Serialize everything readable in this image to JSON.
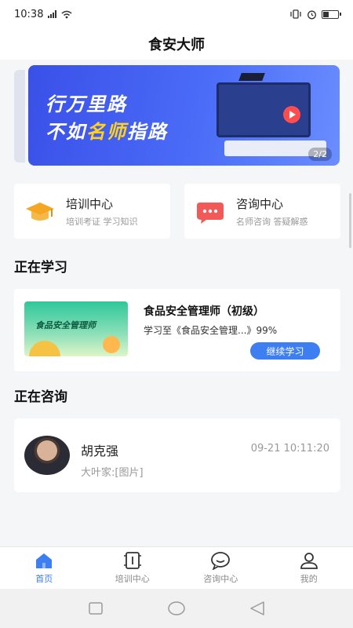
{
  "status_bar": {
    "time": "10:38"
  },
  "header": {
    "title": "食安大师"
  },
  "banner": {
    "line1": "行万里路",
    "line2_prefix": "不如",
    "line2_highlight": "名师",
    "line2_suffix": "指路",
    "page_indicator": "2/2"
  },
  "quick_entries": [
    {
      "title": "培训中心",
      "subtitle": "培训考证 学习知识",
      "icon": "graduation-cap-icon",
      "color": "#f5a623"
    },
    {
      "title": "咨询中心",
      "subtitle": "名师咨询 答疑解惑",
      "icon": "chat-bubble-icon",
      "color": "#f25a5a"
    }
  ],
  "learning": {
    "section_title": "正在学习",
    "course_thumb_title": "食品安全管理师",
    "course_name": "食品安全管理师（初级）",
    "progress_text": "学习至《食品安全管理...》99%",
    "progress_value": 0.99,
    "continue_label": "继续学习"
  },
  "consulting": {
    "section_title": "正在咨询",
    "consultant_name": "胡克强",
    "time": "09-21 10:11:20",
    "last_message": "大叶家:[图片]"
  },
  "tabbar": {
    "items": [
      {
        "label": "首页",
        "icon": "home-icon",
        "active": true
      },
      {
        "label": "培训中心",
        "icon": "training-icon",
        "active": false
      },
      {
        "label": "咨询中心",
        "icon": "chat-icon",
        "active": false
      },
      {
        "label": "我的",
        "icon": "user-icon",
        "active": false
      }
    ]
  },
  "colors": {
    "accent": "#3d7ef0",
    "banner": "#4a6cf7",
    "background": "#f5f6f8"
  }
}
